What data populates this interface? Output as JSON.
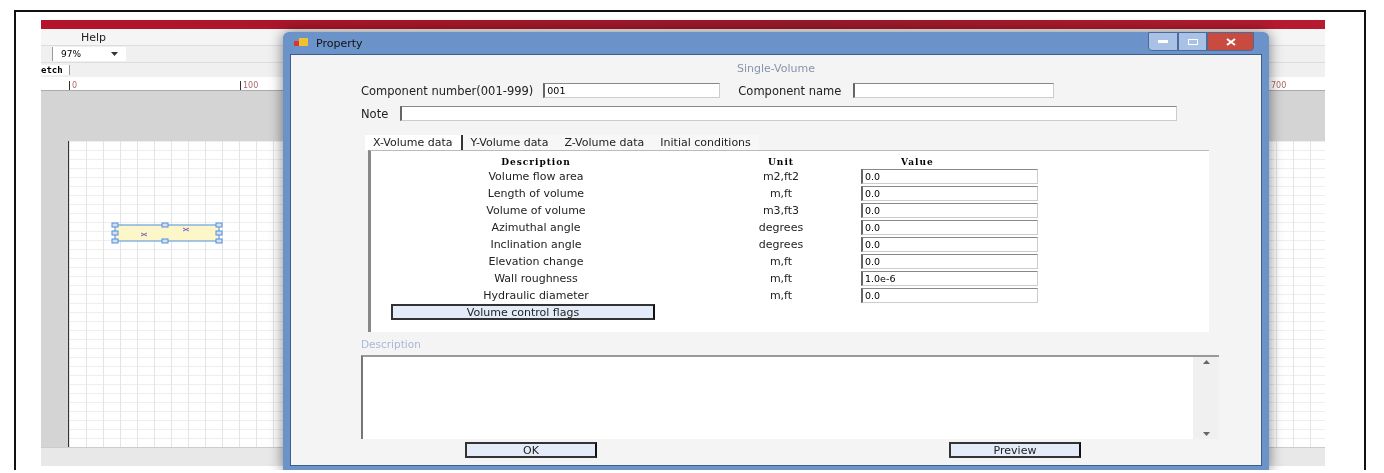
{
  "app": {
    "menu": [
      "Help"
    ],
    "zoom": "97%",
    "doc_tab": "etch",
    "ruler": [
      "0",
      "100",
      "700"
    ]
  },
  "dialog": {
    "title": "Property",
    "heading": "Single-Volume",
    "component_number": {
      "label": "Component number(001-999)",
      "value": "001"
    },
    "component_name": {
      "label": "Component name"
    },
    "note": {
      "label": "Note"
    },
    "tabs": [
      {
        "label": "X-Volume data",
        "selected": true
      },
      {
        "label": "Y-Volume data",
        "selected": false
      },
      {
        "label": "Z-Volume data",
        "selected": false
      },
      {
        "label": "Initial conditions",
        "selected": false
      }
    ],
    "table": {
      "columns": [
        "Description",
        "Unit",
        "Value"
      ],
      "rows": [
        {
          "description": "Volume flow area",
          "unit": "m2,ft2",
          "value": "0.0"
        },
        {
          "description": "Length of volume",
          "unit": "m,ft",
          "value": "0.0"
        },
        {
          "description": "Volume of volume",
          "unit": "m3,ft3",
          "value": "0.0"
        },
        {
          "description": "Azimuthal angle",
          "unit": "degrees",
          "value": "0.0"
        },
        {
          "description": "Inclination angle",
          "unit": "degrees",
          "value": "0.0"
        },
        {
          "description": "Elevation change",
          "unit": "m,ft",
          "value": "0.0"
        },
        {
          "description": "Wall roughness",
          "unit": "m,ft",
          "value": "1.0e-6"
        },
        {
          "description": "Hydraulic diameter",
          "unit": "m,ft",
          "value": "0.0"
        }
      ]
    },
    "flags_button": "Volume control flags",
    "description_label": "Description",
    "buttons": [
      "OK",
      "Preview"
    ]
  }
}
